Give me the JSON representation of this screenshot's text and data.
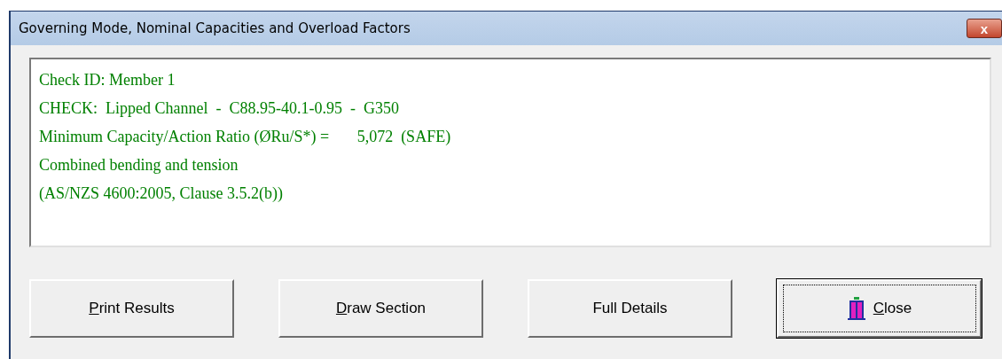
{
  "window": {
    "title": "Governing Mode, Nominal Capacities and Overload Factors",
    "close_label": "x"
  },
  "results": [
    "Check ID: Member 1",
    "CHECK:  Lipped Channel  -  C88.95-40.1-0.95  -  G350",
    "Minimum Capacity/Action Ratio (ØRu/S*) =       5,072  (SAFE)",
    "Combined bending and tension",
    "(AS/NZS 4600:2005, Clause 3.5.2(b))"
  ],
  "buttons": [
    {
      "label": "Print Results",
      "underline_first": true,
      "focused": false,
      "icon": false
    },
    {
      "label": "Draw Section",
      "underline_first": true,
      "focused": false,
      "icon": false
    },
    {
      "label": "Full Details",
      "underline_first": false,
      "focused": false,
      "icon": false
    },
    {
      "label": "Close",
      "underline_first": true,
      "focused": true,
      "icon": true
    }
  ]
}
